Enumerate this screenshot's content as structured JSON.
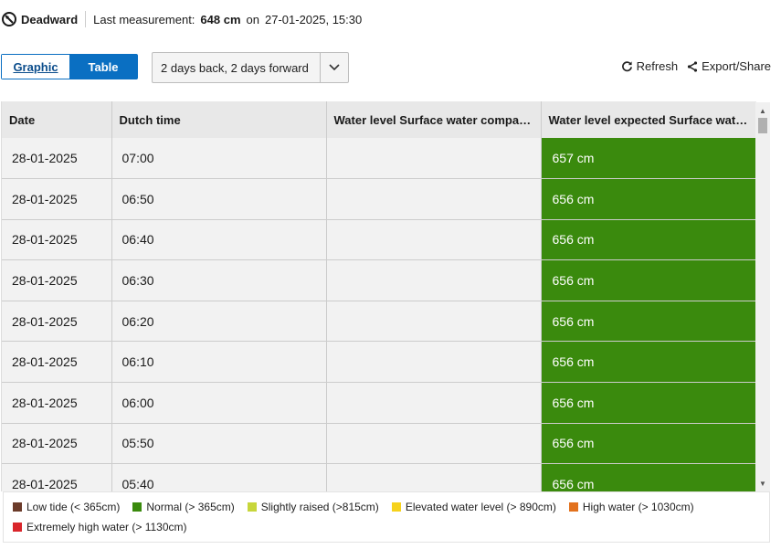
{
  "header": {
    "location_name": "Deadward",
    "last_measurement_label": "Last measurement:",
    "last_measurement_value": "648 cm",
    "on_label": "on",
    "timestamp": "27-01-2025, 15:30"
  },
  "view_toggle": {
    "graphic_label": "Graphic",
    "table_label": "Table",
    "active": "Table"
  },
  "range_select": {
    "value": "2 days back, 2 days forward"
  },
  "actions": {
    "refresh_label": "Refresh",
    "export_label": "Export/Share"
  },
  "table": {
    "columns": [
      "Date",
      "Dutch time",
      "Water level Surface water compared to Normal Amsterdam Level",
      "Water level expected Surface water compared to Normal Amsterdam Level"
    ],
    "rows": [
      {
        "date": "28-01-2025",
        "time": "07:00",
        "measured": "",
        "expected": "657 cm"
      },
      {
        "date": "28-01-2025",
        "time": "06:50",
        "measured": "",
        "expected": "656 cm"
      },
      {
        "date": "28-01-2025",
        "time": "06:40",
        "measured": "",
        "expected": "656 cm"
      },
      {
        "date": "28-01-2025",
        "time": "06:30",
        "measured": "",
        "expected": "656 cm"
      },
      {
        "date": "28-01-2025",
        "time": "06:20",
        "measured": "",
        "expected": "656 cm"
      },
      {
        "date": "28-01-2025",
        "time": "06:10",
        "measured": "",
        "expected": "656 cm"
      },
      {
        "date": "28-01-2025",
        "time": "06:00",
        "measured": "",
        "expected": "656 cm"
      },
      {
        "date": "28-01-2025",
        "time": "05:50",
        "measured": "",
        "expected": "656 cm"
      },
      {
        "date": "28-01-2025",
        "time": "05:40",
        "measured": "",
        "expected": "656 cm"
      }
    ]
  },
  "legend": [
    {
      "label": "Low tide (< 365cm)",
      "color": "#6b3b2a"
    },
    {
      "label": "Normal (> 365cm)",
      "color": "#3a8a0d"
    },
    {
      "label": "Slightly raised (>815cm)",
      "color": "#c7d63b"
    },
    {
      "label": "Elevated water level (> 890cm)",
      "color": "#f6d21c"
    },
    {
      "label": "High water (> 1030cm)",
      "color": "#e2711d"
    },
    {
      "label": "Extremely high water (> 1130cm)",
      "color": "#d9262b"
    }
  ],
  "colors": {
    "accent": "#0a6fc2",
    "normal": "#3a8a0d"
  }
}
